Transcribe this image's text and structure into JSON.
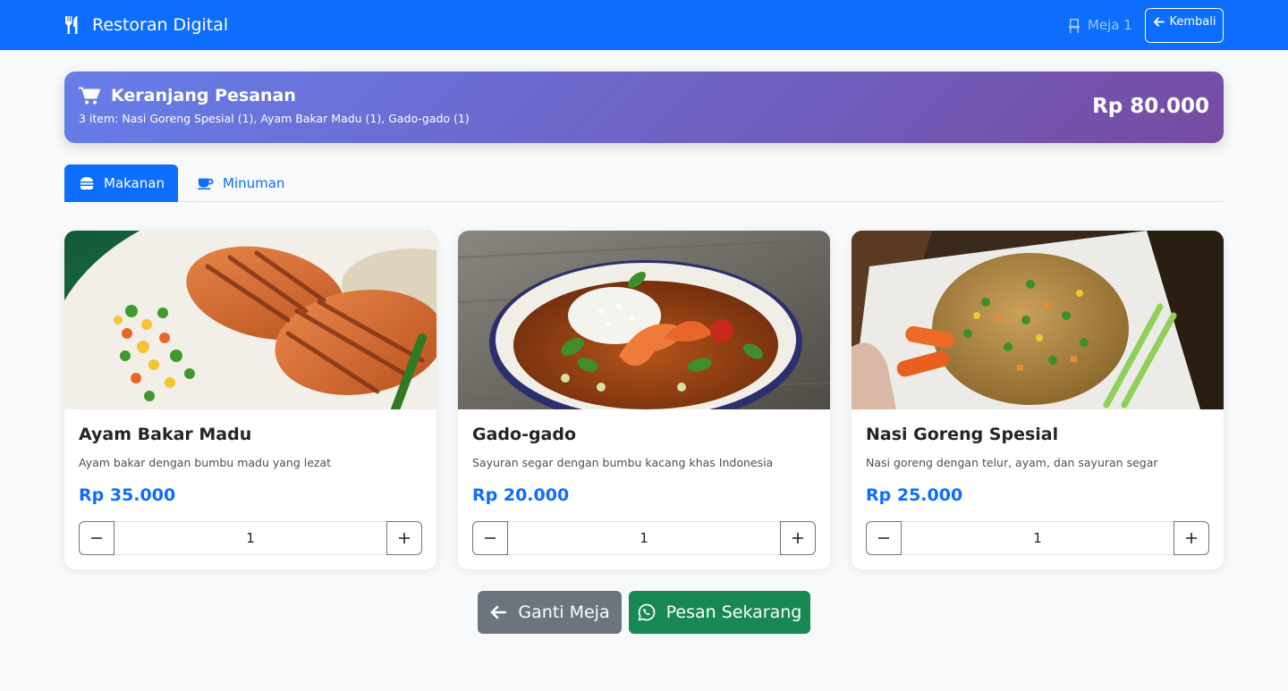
{
  "app": {
    "title": "Restoran Digital"
  },
  "navbar": {
    "table_label": "Meja 1",
    "back_label": "Kembali"
  },
  "cart": {
    "title": "Keranjang Pesanan",
    "items_summary": "3 item: Nasi Goreng Spesial (1), Ayam Bakar Madu (1), Gado-gado (1)",
    "total": "Rp 80.000"
  },
  "tabs": [
    {
      "label": "Makanan",
      "active": true,
      "icon": "burger-icon"
    },
    {
      "label": "Minuman",
      "active": false,
      "icon": "coffee-icon"
    }
  ],
  "menu": [
    {
      "name": "Ayam Bakar Madu",
      "description": "Ayam bakar dengan bumbu madu yang lezat",
      "price": "Rp 35.000",
      "quantity": "1"
    },
    {
      "name": "Gado-gado",
      "description": "Sayuran segar dengan bumbu kacang khas Indonesia",
      "price": "Rp 20.000",
      "quantity": "1"
    },
    {
      "name": "Nasi Goreng Spesial",
      "description": "Nasi goreng dengan telur, ayam, dan sayuran segar",
      "price": "Rp 25.000",
      "quantity": "1"
    }
  ],
  "actions": {
    "change_table": "Ganti Meja",
    "order_now": "Pesan Sekarang"
  },
  "colors": {
    "primary": "#0d6efd",
    "secondary": "#6c757d",
    "success": "#198754",
    "gradient_start": "#667eea",
    "gradient_end": "#764ba2"
  }
}
